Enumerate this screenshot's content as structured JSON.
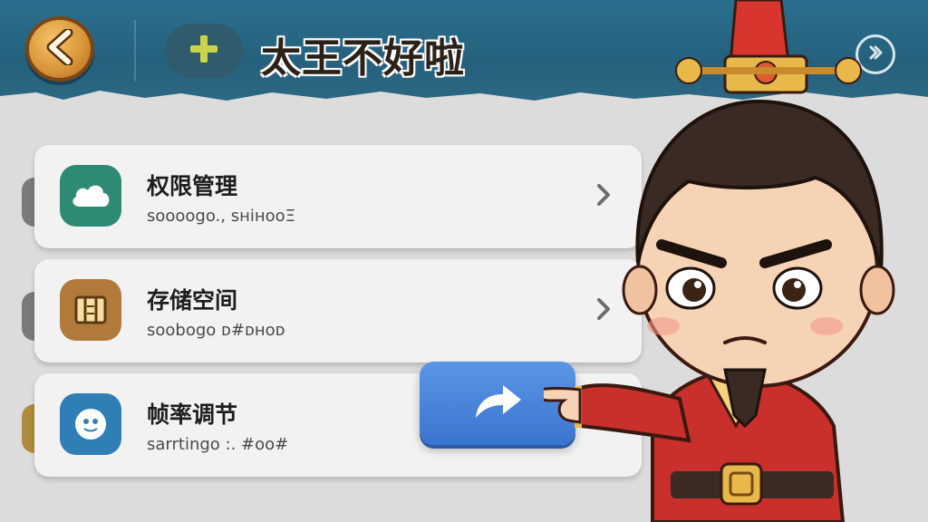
{
  "header": {
    "title": "太王不好啦",
    "back_icon": "chevron-left-icon",
    "add_icon": "plus-icon",
    "corner_icon": "forward-circle-icon"
  },
  "colors": {
    "header_bg": "#2a6f8e",
    "card_bg": "#f2f2f2",
    "accent_gold": "#d79236",
    "share_button": "#3b74cf"
  },
  "settings": {
    "items": [
      {
        "label": "权限管理",
        "subtitle": "soooogo., sнінооΞ",
        "icon": "cloud-icon",
        "icon_color": "#2e8a73"
      },
      {
        "label": "存储空间",
        "subtitle": "soobogo ᴅ#ᴅнᴏᴅ",
        "icon": "storage-box-icon",
        "icon_color": "#b17a3a"
      },
      {
        "label": "帧率调节",
        "subtitle": "sarrtingo :. #oo#",
        "icon": "face-dial-icon",
        "icon_color": "#2f7fb6"
      }
    ]
  },
  "share_button": {
    "icon": "share-arrow-icon"
  },
  "character": {
    "icon": "emperor-character"
  }
}
